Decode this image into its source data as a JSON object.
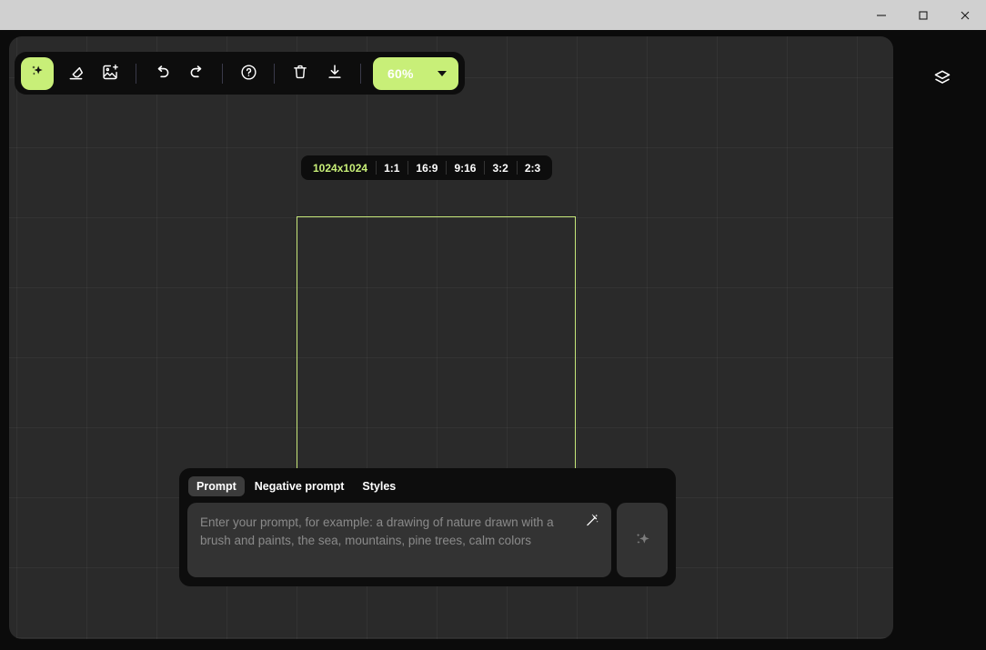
{
  "window": {
    "controls": [
      {
        "name": "minimize",
        "icon": "minimize-icon"
      },
      {
        "name": "maximize",
        "icon": "maximize-icon"
      },
      {
        "name": "close",
        "icon": "close-icon"
      }
    ]
  },
  "colors": {
    "accent": "#c8ef78",
    "panel_dark": "#0d0d0d",
    "canvas": "#2a2a2a",
    "input": "#333333",
    "frame_border": "#c7e87a"
  },
  "toolbar": {
    "tools": [
      {
        "id": "generate",
        "icon": "sparkle-icon",
        "label": "Generate",
        "active": true
      },
      {
        "id": "eraser",
        "icon": "eraser-icon",
        "label": "Eraser",
        "active": false
      },
      {
        "id": "add-image",
        "icon": "add-image-icon",
        "label": "Add image",
        "active": false
      },
      {
        "id": "undo",
        "icon": "undo-icon",
        "label": "Undo",
        "active": false
      },
      {
        "id": "redo",
        "icon": "redo-icon",
        "label": "Redo",
        "active": false
      },
      {
        "id": "help",
        "icon": "help-circle-icon",
        "label": "Help",
        "active": false
      },
      {
        "id": "delete",
        "icon": "trash-icon",
        "label": "Delete",
        "active": false
      },
      {
        "id": "download",
        "icon": "download-icon",
        "label": "Download",
        "active": false
      }
    ],
    "zoom": {
      "value": "60%",
      "icon": "chevron-down-icon"
    }
  },
  "layers": {
    "icon": "layers-icon",
    "label": "Layers"
  },
  "aspect_ratios": {
    "options": [
      {
        "label": "1024x1024",
        "selected": true
      },
      {
        "label": "1:1",
        "selected": false
      },
      {
        "label": "16:9",
        "selected": false
      },
      {
        "label": "9:16",
        "selected": false
      },
      {
        "label": "3:2",
        "selected": false
      },
      {
        "label": "2:3",
        "selected": false
      }
    ]
  },
  "artboard": {
    "label": "artboard-selection"
  },
  "prompt_panel": {
    "tabs": [
      {
        "label": "Prompt",
        "active": true
      },
      {
        "label": "Negative prompt",
        "active": false
      },
      {
        "label": "Styles",
        "active": false
      }
    ],
    "input": {
      "value": "",
      "placeholder": "Enter your prompt, for example: a drawing of nature drawn with a brush and paints, the sea, mountains, pine trees, calm colors"
    },
    "enhance": {
      "icon": "magic-wand-icon",
      "label": "Enhance prompt"
    },
    "generate": {
      "icon": "sparkle-icon",
      "label": "Generate"
    }
  }
}
